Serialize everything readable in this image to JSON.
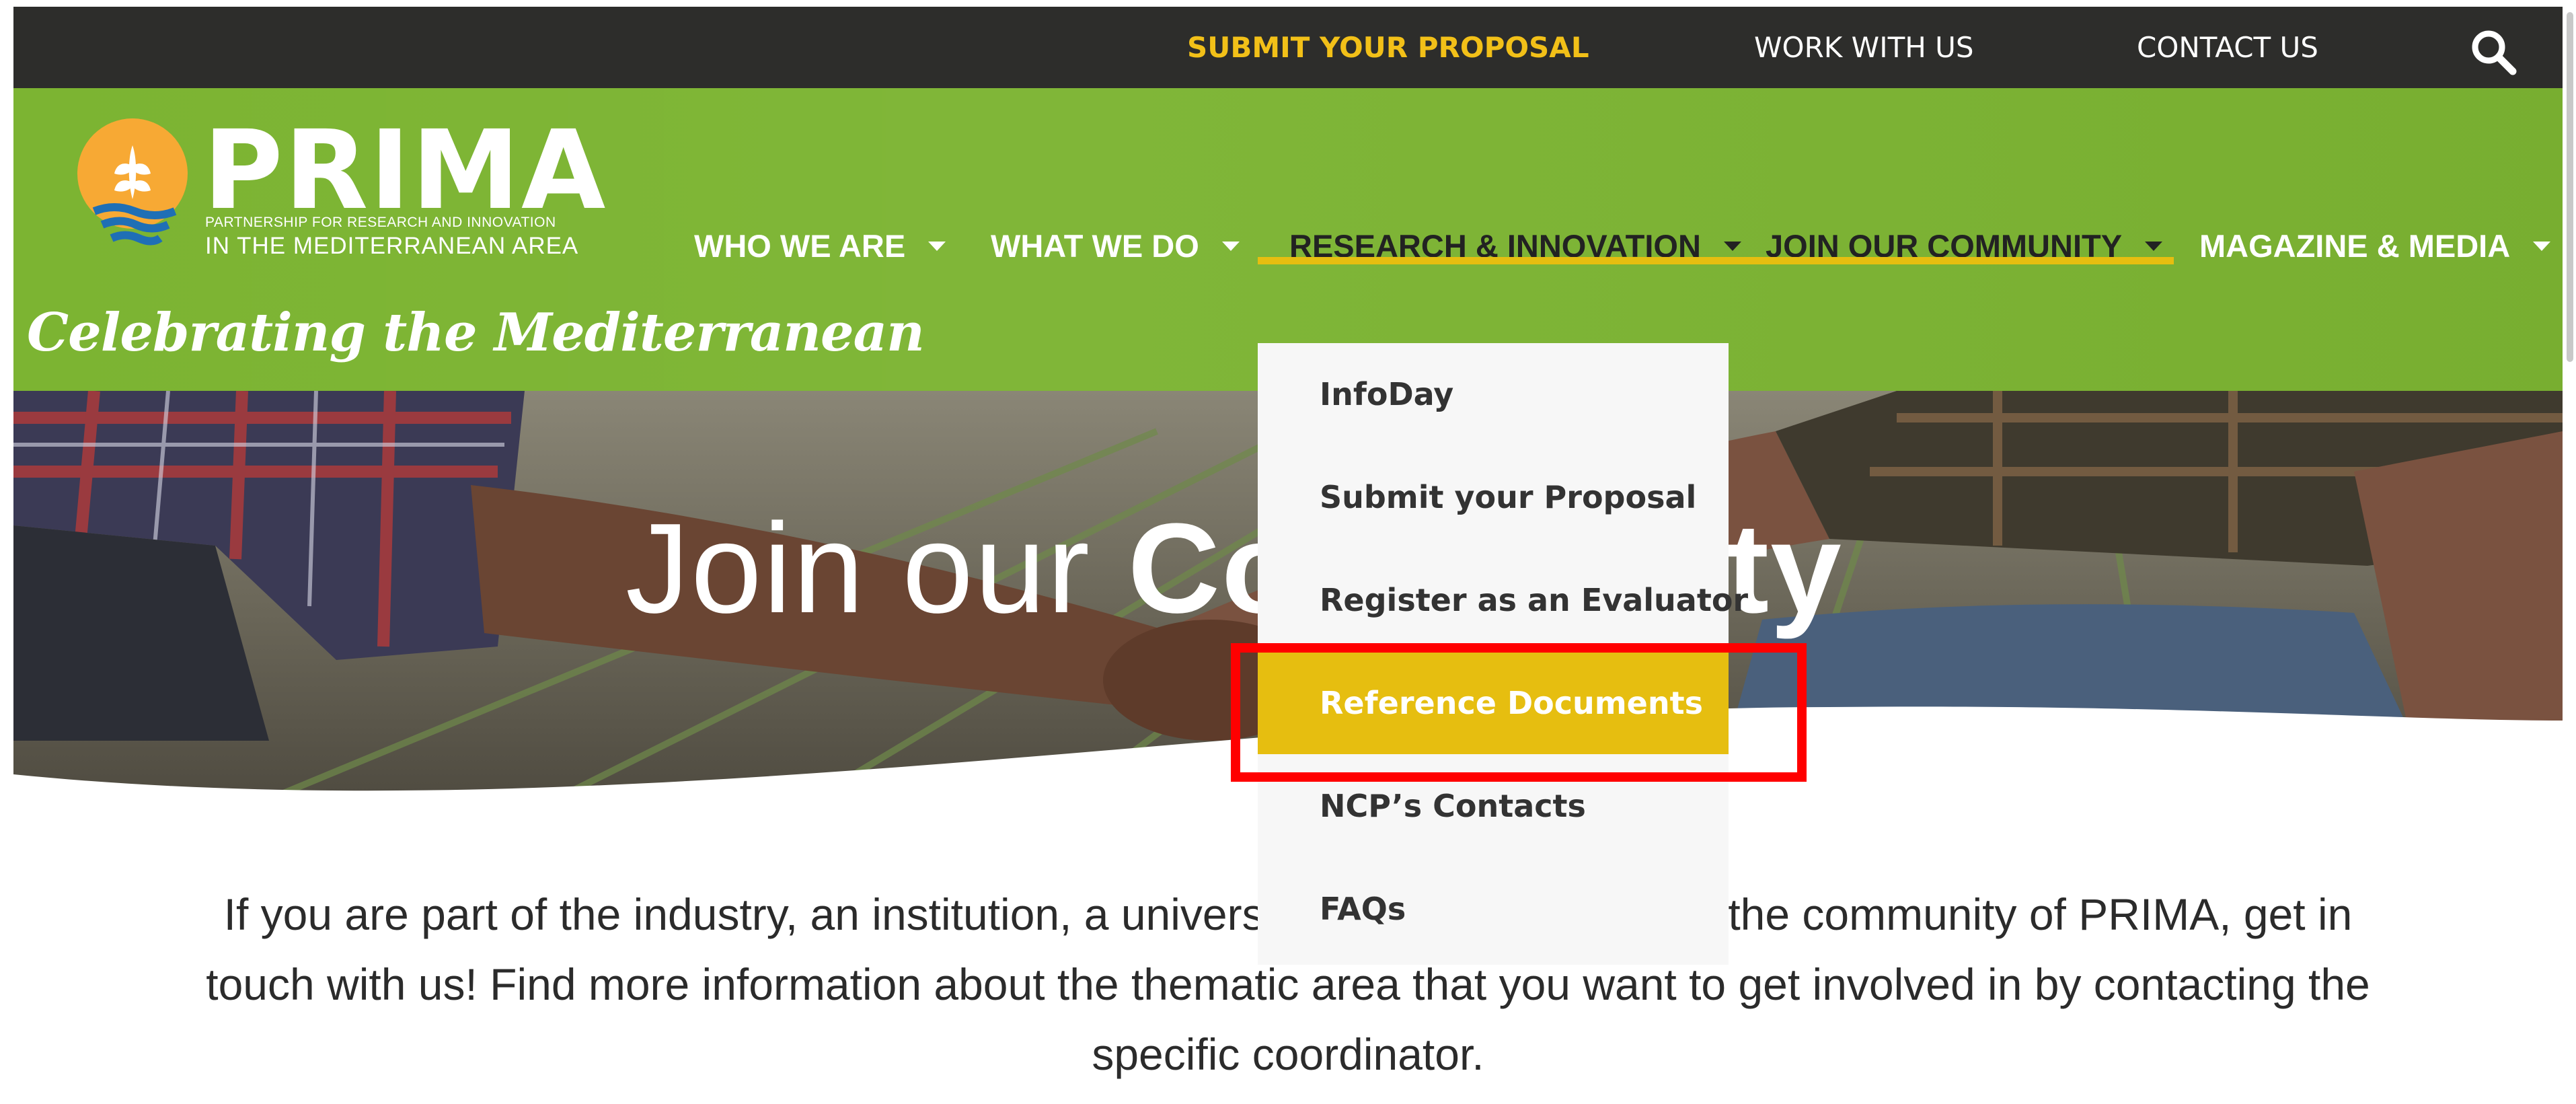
{
  "topbar": {
    "submit_proposal": "SUBMIT YOUR PROPOSAL",
    "work_with_us": "WORK WITH US",
    "contact_us": "CONTACT US",
    "search_icon": "search-icon"
  },
  "logo": {
    "name": "PRIMA",
    "subtitle_line1": "PARTNERSHIP FOR RESEARCH AND INNOVATION",
    "subtitle_line2": "IN THE MEDITERRANEAN AREA",
    "tagline": "Celebrating the Mediterranean"
  },
  "nav": {
    "items": [
      {
        "label": "WHO WE ARE"
      },
      {
        "label": "WHAT WE DO"
      },
      {
        "label": "RESEARCH & INNOVATION"
      },
      {
        "label": "JOIN OUR COMMUNITY"
      },
      {
        "label": "MAGAZINE & MEDIA"
      }
    ]
  },
  "dropdown": {
    "items": [
      {
        "label": "InfoDay"
      },
      {
        "label": "Submit your Proposal"
      },
      {
        "label": "Register as an Evaluator"
      },
      {
        "label": "Reference Documents"
      },
      {
        "label": "NCP’s Contacts"
      },
      {
        "label": "FAQs"
      }
    ],
    "active_index": 3
  },
  "hero": {
    "title_light": "Join our ",
    "title_bold": "Community"
  },
  "intro": {
    "text": "If you are part of the industry, an institution, a university and you want to join the community of PRIMA, get in touch with us! Find more information about the thematic area that you want to get involved in by contacting the specific coordinator."
  },
  "colors": {
    "topbar_bg": "#2d2d2b",
    "header_green": "#7cb432",
    "accent_yellow": "#e6be10",
    "highlight_red": "#ff0000"
  }
}
